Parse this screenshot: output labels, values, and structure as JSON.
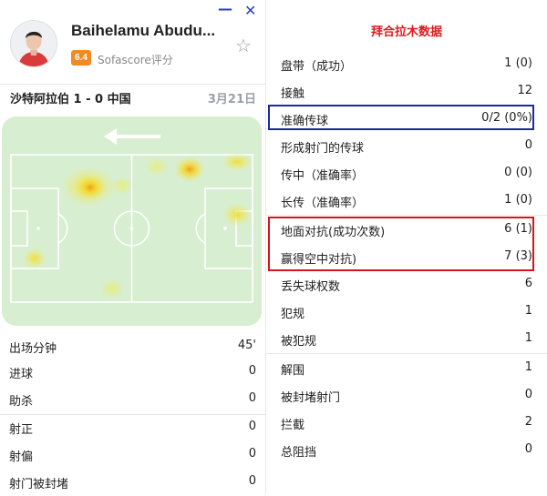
{
  "window": {
    "minimize_glyph": "—",
    "close_glyph": "✕"
  },
  "player": {
    "name": "Baihelamu Abudu...",
    "rating": "6.4",
    "rating_source": "Sofascore评分",
    "rating_color": "#f08a24",
    "favorite_icon": "star-outline-icon"
  },
  "match": {
    "score_line": "沙特阿拉伯 1 - 0 中国",
    "date": "3月21日"
  },
  "heatmap": {
    "pitch_color": "#d7eed0",
    "attack_direction": "left",
    "arrow_icon": "arrow-left-icon"
  },
  "left_stats": [
    {
      "label": "出场分钟",
      "value": "45'"
    },
    {
      "label": "进球",
      "value": "0"
    },
    {
      "label": "助杀",
      "value": "0"
    },
    {
      "label": "射正",
      "value": "0"
    },
    {
      "label": "射偏",
      "value": "0"
    },
    {
      "label": "射门被封堵",
      "value": "0"
    }
  ],
  "right_panel": {
    "title": "拜合拉木数据",
    "title_color": "#e0181b",
    "stats": [
      {
        "label": "盘带（成功）",
        "value": "1 (0)"
      },
      {
        "label": "接触",
        "value": "12"
      },
      {
        "label": "准确传球",
        "value": "0/2 (0%)"
      },
      {
        "label": "形成射门的传球",
        "value": "0"
      },
      {
        "label": "传中（准确率）",
        "value": "0 (0)"
      },
      {
        "label": "长传（准确率）",
        "value": "1 (0)"
      },
      {
        "label": "地面对抗(成功次数)",
        "value": "6 (1)"
      },
      {
        "label": "赢得空中对抗)",
        "value": "7 (3)"
      },
      {
        "label": "丢失球权数",
        "value": "6"
      },
      {
        "label": "犯规",
        "value": "1"
      },
      {
        "label": "被犯规",
        "value": "1"
      },
      {
        "label": "解围",
        "value": "1"
      },
      {
        "label": "被封堵射门",
        "value": "0"
      },
      {
        "label": "拦截",
        "value": "2"
      },
      {
        "label": "总阻挡",
        "value": "0"
      }
    ],
    "highlight_blue": "#1c2a9b",
    "highlight_red": "#d8141b"
  }
}
